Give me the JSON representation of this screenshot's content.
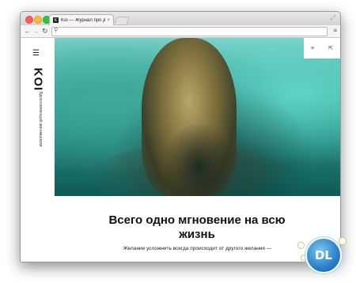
{
  "browser": {
    "tab_title": "Koi — Журнал про дизайн",
    "tab_favicon": "K",
    "tab_close_icon": "×",
    "nav_back_icon": "arrow-left-icon",
    "nav_forward_icon": "arrow-right-icon",
    "reload_icon": "reload-icon",
    "search_icon": "search-icon",
    "menu_icon": "hamburger-menu-icon",
    "url": ""
  },
  "sidebar": {
    "logo": "KOI",
    "tagline": "Вдохновляющий минимализм"
  },
  "hero": {
    "menu_icon": "≡",
    "share_icon": "⇱"
  },
  "article": {
    "title": "Всего одно мгновение на всю жизнь",
    "lead": "Желание усложнить всегда происходит от другого желания —"
  },
  "watermark": {
    "text": "DL"
  },
  "colors": {
    "traffic_red": "#fc5f57",
    "traffic_yellow": "#fdbc2e",
    "traffic_green": "#28c840",
    "hero_teal": "#2e9c90"
  }
}
